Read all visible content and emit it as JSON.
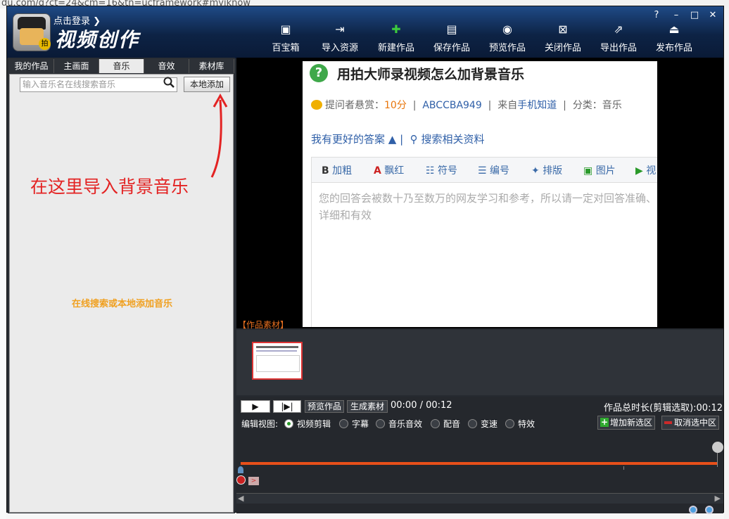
{
  "browser_bg": {
    "url_fragment": "du.com/q?ct=24&cm=16&tn=ucframework#myiknow"
  },
  "app": {
    "login": "点击登录 ❯",
    "title": "视频创作",
    "logo_badge": "拍"
  },
  "toolbar": [
    {
      "label": "百宝箱",
      "icon": "treasure-box-icon"
    },
    {
      "label": "导入资源",
      "icon": "import-icon"
    },
    {
      "label": "新建作品",
      "icon": "new-icon"
    },
    {
      "label": "保存作品",
      "icon": "save-icon"
    },
    {
      "label": "预览作品",
      "icon": "eye-icon"
    },
    {
      "label": "关闭作品",
      "icon": "close-file-icon"
    },
    {
      "label": "导出作品",
      "icon": "export-icon"
    },
    {
      "label": "发布作品",
      "icon": "upload-icon"
    }
  ],
  "window_controls": {
    "help": "?",
    "minimize": "–",
    "maximize": "□",
    "close": "✕"
  },
  "tabs": [
    {
      "label": "我的作品"
    },
    {
      "label": "主画面"
    },
    {
      "label": "音乐",
      "active": true
    },
    {
      "label": "音效"
    },
    {
      "label": "素材库"
    }
  ],
  "music_pane": {
    "search_placeholder": "输入音乐名在线搜索音乐",
    "add_local": "本地添加",
    "annotation": "在这里导入背景音乐",
    "hint": "在线搜索或本地添加音乐"
  },
  "preview": {
    "question_mark": "?",
    "title": "用拍大师录视频怎么加背景音乐",
    "reward_label": "提问者悬赏：",
    "reward_value": "10分",
    "user": "ABCCBA949",
    "source_prefix": "来自",
    "source": "手机知道",
    "category": "分类：音乐",
    "better_answer": "我有更好的答案 ▲",
    "search_related": "搜索相关资料",
    "editor_tools": [
      "加粗",
      "飘红",
      "符号",
      "编号",
      "排版",
      "图片",
      "视"
    ],
    "editor_placeholder": "您的回答会被数十乃至数万的网友学习和参考，所以请一定对回答准确、详细和有效"
  },
  "material_label": "【作品素材】",
  "controls": {
    "play": "▶",
    "step": "|▶|",
    "preview_btn": "预览作品",
    "gen_btn": "生成素材",
    "time": "00:00 / 00:12",
    "total": "作品总时长(剪辑选取):00:12",
    "view_label": "编辑视图:",
    "views": [
      "视频剪辑",
      "字幕",
      "音乐音效",
      "配音",
      "变速",
      "特效"
    ],
    "selected_view": "视频剪辑",
    "add_selection": "增加新选区",
    "cancel_selection": "取消选中区",
    "marker_arrow": ">"
  },
  "colors": {
    "accent_orange": "#e8501a",
    "annotation_red": "#e32323",
    "hint_orange": "#f0a020"
  }
}
